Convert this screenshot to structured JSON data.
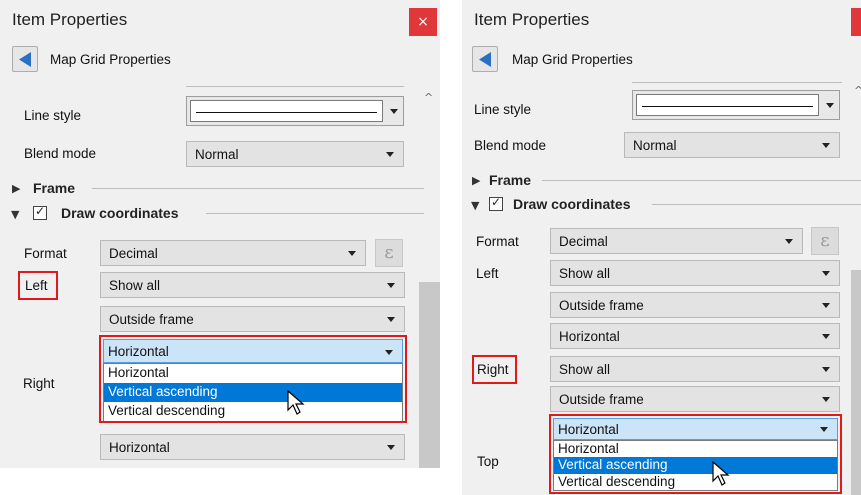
{
  "left_panel": {
    "title": "Item Properties",
    "close_glyph": "×",
    "header": "Map Grid Properties",
    "labels": {
      "line_style": "Line style",
      "blend_mode": "Blend mode",
      "frame": "Frame",
      "draw_coordinates": "Draw coordinates",
      "format": "Format",
      "left": "Left",
      "right": "Right"
    },
    "combos": {
      "blend_mode": "Normal",
      "format": "Decimal",
      "left_display": "Show all",
      "left_position": "Outside frame",
      "right_direction": "Horizontal",
      "lower_direction": "Horizontal"
    },
    "dropdown_items": [
      "Horizontal",
      "Vertical ascending",
      "Vertical descending"
    ],
    "dropdown_highlighted": "Vertical ascending",
    "expression_glyph": "ε",
    "check_glyph": "✓",
    "scroll_up_glyph": "^"
  },
  "right_panel": {
    "title": "Item Properties",
    "close_glyph": "×",
    "header": "Map Grid Properties",
    "labels": {
      "line_style": "Line style",
      "blend_mode": "Blend mode",
      "frame": "Frame",
      "draw_coordinates": "Draw coordinates",
      "format": "Format",
      "left": "Left",
      "right": "Right",
      "top": "Top"
    },
    "combos": {
      "blend_mode": "Normal",
      "format": "Decimal",
      "left_display": "Show all",
      "left_position": "Outside frame",
      "left_direction": "Horizontal",
      "right_display": "Show all",
      "right_position": "Outside frame",
      "top_direction": "Horizontal"
    },
    "dropdown_items": [
      "Horizontal",
      "Vertical ascending",
      "Vertical descending"
    ],
    "dropdown_highlighted": "Vertical ascending",
    "expression_glyph": "ε",
    "check_glyph": "✓",
    "scroll_up_glyph": "^"
  },
  "colors": {
    "highlight": "#0078d7",
    "callout_red": "#e0191b",
    "close_button": "#e0373b",
    "selected_combo": "#cce4f7"
  },
  "icons": [
    "back-arrow-icon",
    "close-icon",
    "expand-triangle-icon",
    "collapse-triangle-icon",
    "checkbox-icon",
    "expression-icon",
    "dropdown-arrow-icon",
    "mouse-pointer-icon"
  ]
}
